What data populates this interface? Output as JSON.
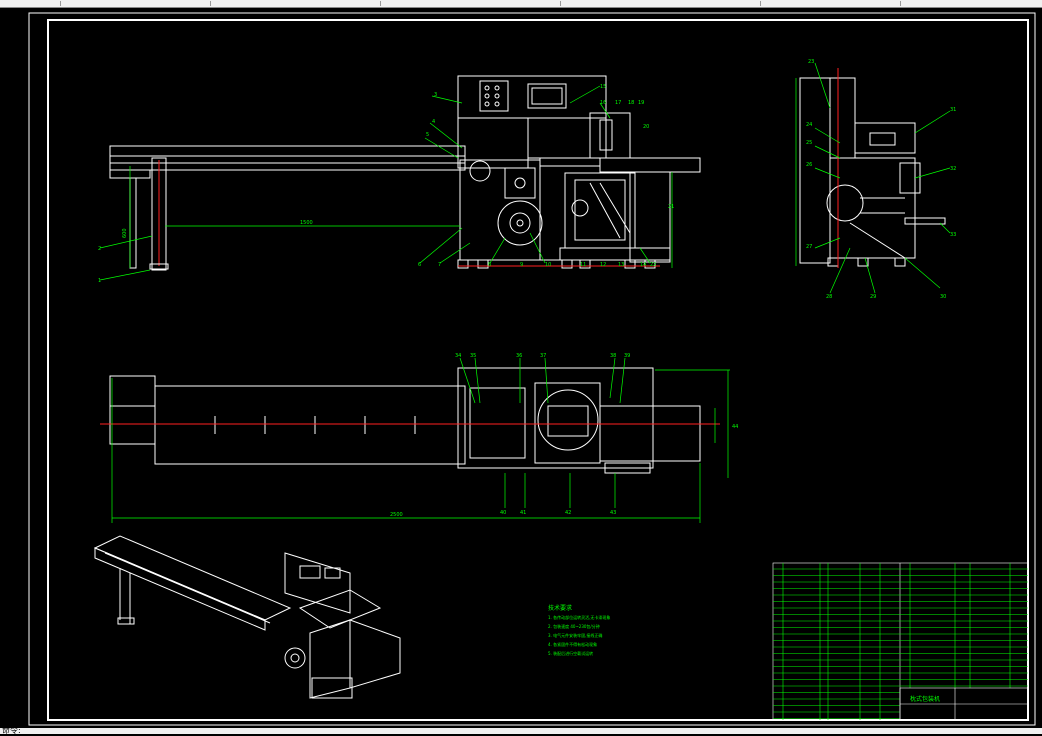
{
  "window": {
    "status_text": "命令:"
  },
  "drawing": {
    "dimension_overall_length": "2500",
    "dimension_conveyor": "1500",
    "dimension_height": "600",
    "tech_req_title": "技术要求",
    "tech_req_lines": [
      "1. 各传动部位运转灵活,无卡滞现象",
      "2. 包装速度 40~230包/分钟",
      "3. 电气元件安装牢固,接线正确",
      "4. 各紧固件不得有松动现象",
      "5. 装配后进行空载试运转"
    ],
    "title_block_name": "枕式包装机",
    "callouts_front": [
      "1",
      "2",
      "3",
      "4",
      "5",
      "6",
      "7",
      "8",
      "9",
      "10",
      "11",
      "12",
      "13",
      "14",
      "15",
      "16",
      "17",
      "18",
      "19",
      "20",
      "21",
      "22"
    ],
    "callouts_side": [
      "23",
      "24",
      "25",
      "26",
      "27",
      "28",
      "29",
      "30",
      "31",
      "32",
      "33"
    ],
    "callouts_top": [
      "34",
      "35",
      "36",
      "37",
      "38",
      "39",
      "40",
      "41",
      "42",
      "43",
      "44"
    ]
  },
  "colors": {
    "background": "#000000",
    "frame": "#ffffff",
    "dimension": "#00ff00",
    "centerline": "#ff2020",
    "text_green": "#00ff00"
  }
}
